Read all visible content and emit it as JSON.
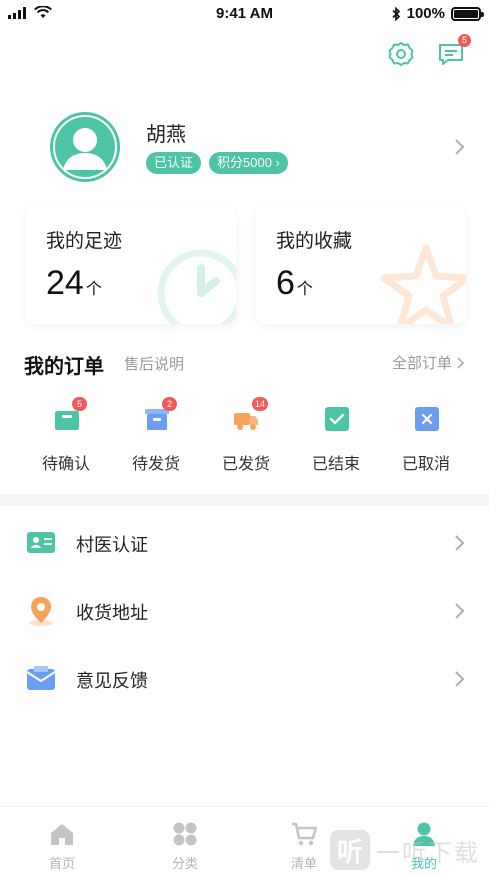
{
  "status_bar": {
    "time": "9:41 AM",
    "battery": "100%"
  },
  "header": {
    "message_badge": "5"
  },
  "profile": {
    "name": "胡燕",
    "tag_verified": "已认证",
    "tag_points": "积分5000 ›"
  },
  "cards": {
    "footprint": {
      "title": "我的足迹",
      "count": "24",
      "unit": "个"
    },
    "favorites": {
      "title": "我的收藏",
      "count": "6",
      "unit": "个"
    }
  },
  "orders": {
    "title": "我的订单",
    "subtitle": "售后说明",
    "all_label": "全部订单",
    "items": [
      {
        "label": "待确认",
        "badge": "5",
        "icon": "pending-confirm-icon",
        "color": "#4ec4a6"
      },
      {
        "label": "待发货",
        "badge": "2",
        "icon": "pending-ship-icon",
        "color": "#6b9df0"
      },
      {
        "label": "已发货",
        "badge": "14",
        "icon": "shipped-truck-icon",
        "color": "#f6a35a"
      },
      {
        "label": "已结束",
        "badge": "",
        "icon": "finished-check-icon",
        "color": "#4ec4a6"
      },
      {
        "label": "已取消",
        "badge": "",
        "icon": "cancelled-x-icon",
        "color": "#6b9df0"
      }
    ]
  },
  "menu": [
    {
      "label": "村医认证",
      "icon": "id-card-icon"
    },
    {
      "label": "收货地址",
      "icon": "location-pin-icon"
    },
    {
      "label": "意见反馈",
      "icon": "mail-icon"
    }
  ],
  "tabbar": [
    {
      "label": "首页",
      "icon": "home-icon",
      "active": false
    },
    {
      "label": "分类",
      "icon": "category-icon",
      "active": false
    },
    {
      "label": "清单",
      "icon": "cart-icon",
      "active": false
    },
    {
      "label": "我的",
      "icon": "profile-icon",
      "active": true
    }
  ],
  "watermark": {
    "text": "一听下载"
  },
  "colors": {
    "accent": "#4ec4a6",
    "badge": "#f25a5a",
    "muted": "#9a9a9a"
  }
}
